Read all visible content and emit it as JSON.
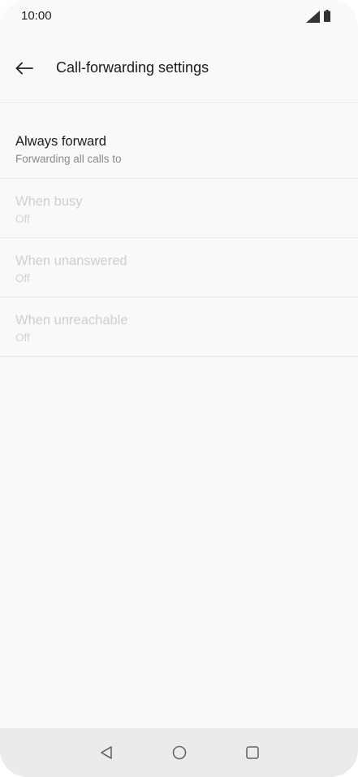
{
  "status_bar": {
    "time": "10:00",
    "icons": [
      "signal-icon",
      "battery-icon"
    ]
  },
  "app_bar": {
    "back_icon": "arrow-left-icon",
    "title": "Call-forwarding settings"
  },
  "settings": [
    {
      "title": "Always forward",
      "summary": "Forwarding all calls to",
      "enabled": true
    },
    {
      "title": "When busy",
      "summary": "Off",
      "enabled": false
    },
    {
      "title": "When unanswered",
      "summary": "Off",
      "enabled": false
    },
    {
      "title": "When unreachable",
      "summary": "Off",
      "enabled": false
    }
  ],
  "nav_bar": {
    "icons": [
      "nav-back-icon",
      "nav-home-icon",
      "nav-recents-icon"
    ]
  },
  "colors": {
    "background": "#f9f9f9",
    "primary_text": "#1c1c1c",
    "secondary_text": "#8a8a8a",
    "disabled_text": "#cfcfcf",
    "nav_bar": "#ebebeb"
  }
}
